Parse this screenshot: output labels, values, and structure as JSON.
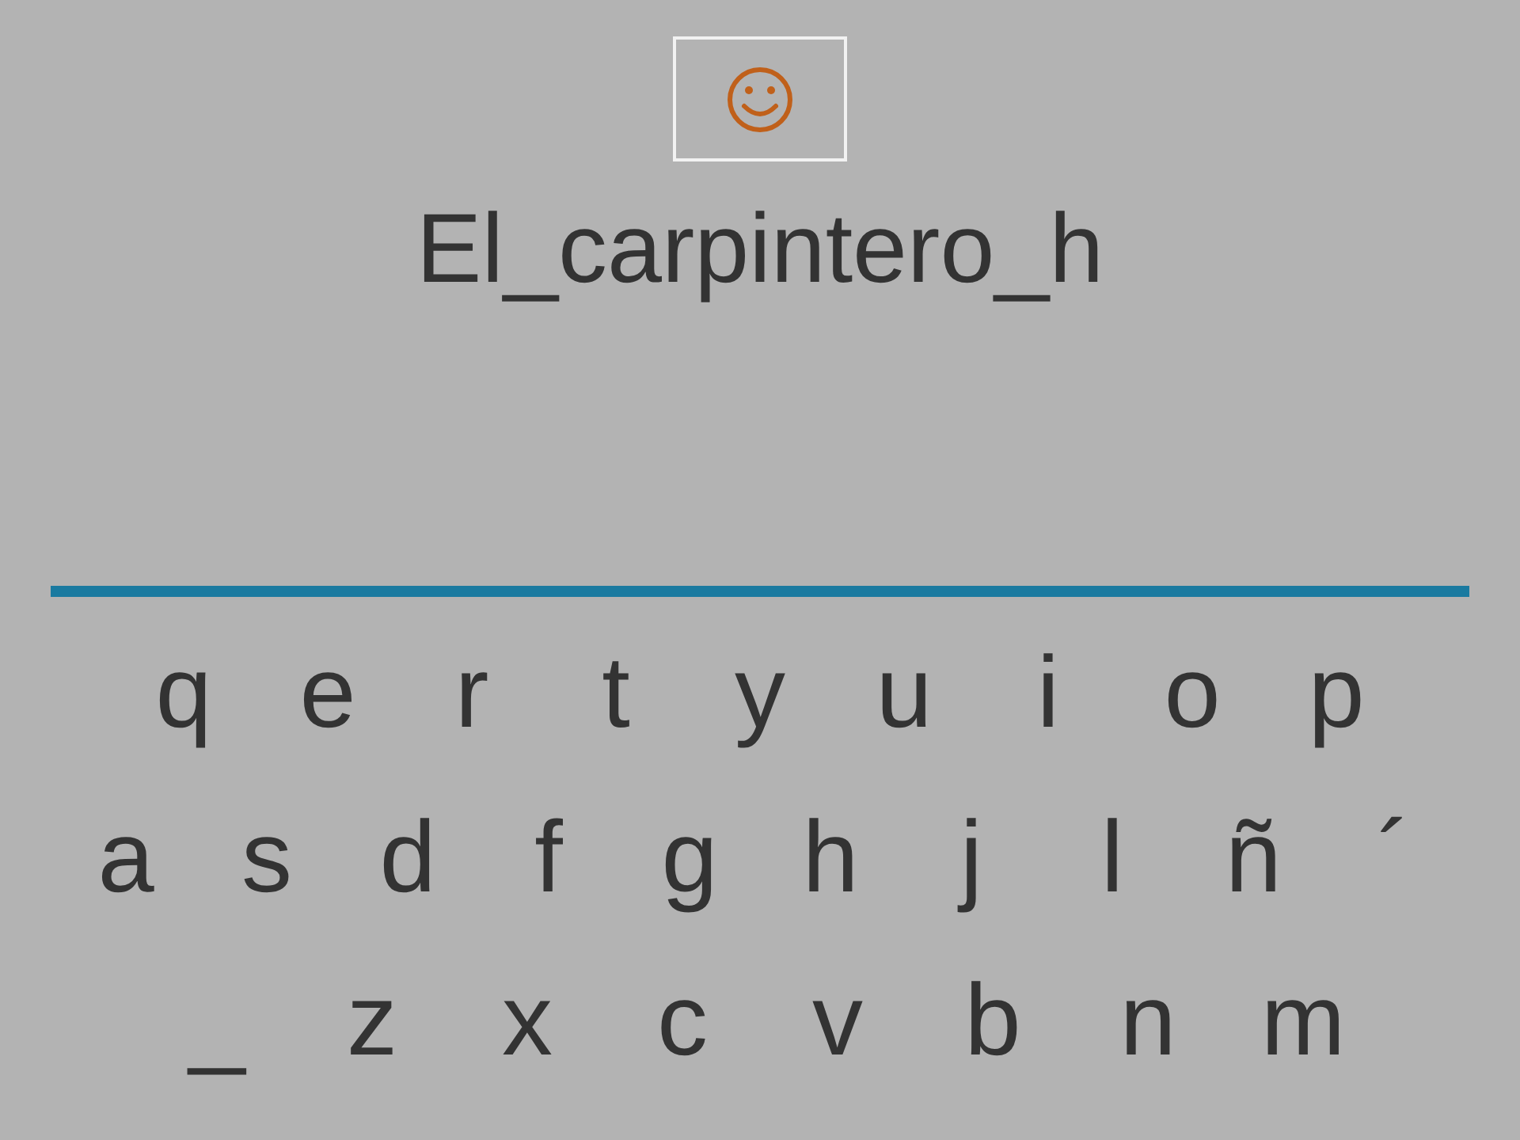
{
  "sentence": "El_carpintero_h",
  "keyboard": {
    "rows": [
      [
        "q",
        "e",
        "r",
        "t",
        "y",
        "u",
        "i",
        "o",
        "p"
      ],
      [
        "a",
        "s",
        "d",
        "f",
        "g",
        "h",
        "j",
        "l",
        "ñ",
        "´"
      ],
      [
        "_",
        "z",
        "x",
        "c",
        "v",
        "b",
        "n",
        "m"
      ]
    ]
  }
}
